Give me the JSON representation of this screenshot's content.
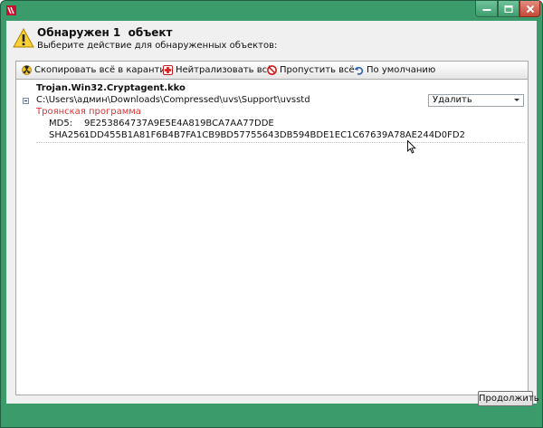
{
  "header": {
    "title": "Обнаружен 1  объект",
    "subtitle": "Выберите действие для обнаруженных объектов:"
  },
  "toolbar": {
    "quarantine_all": "Скопировать всё в карантин",
    "neutralize_all": "Нейтрализовать всё",
    "skip_all": "Пропустить всё",
    "default": "По умолчанию"
  },
  "detection": {
    "name": "Trojan.Win32.Cryptagent.kko",
    "path": "C:\\Users\\админ\\Downloads\\Compressed\\uvs\\Support\\uvsstd",
    "type": "Троянская программа",
    "md5_label": "MD5:",
    "md5": "9E253864737A9E5E4A819BCA7AA77DDE",
    "sha256_label": "SHA256:",
    "sha256": "1DD455B1A81F6B4B7FA1CB9BD57755643DB594BDE1EC1C67639A78AE244D0FD2",
    "action": "Удалить"
  },
  "footer": {
    "continue_label": "Продолжить"
  },
  "colors": {
    "window_frame": "#3c9b6b",
    "threat_type": "#e03030"
  }
}
